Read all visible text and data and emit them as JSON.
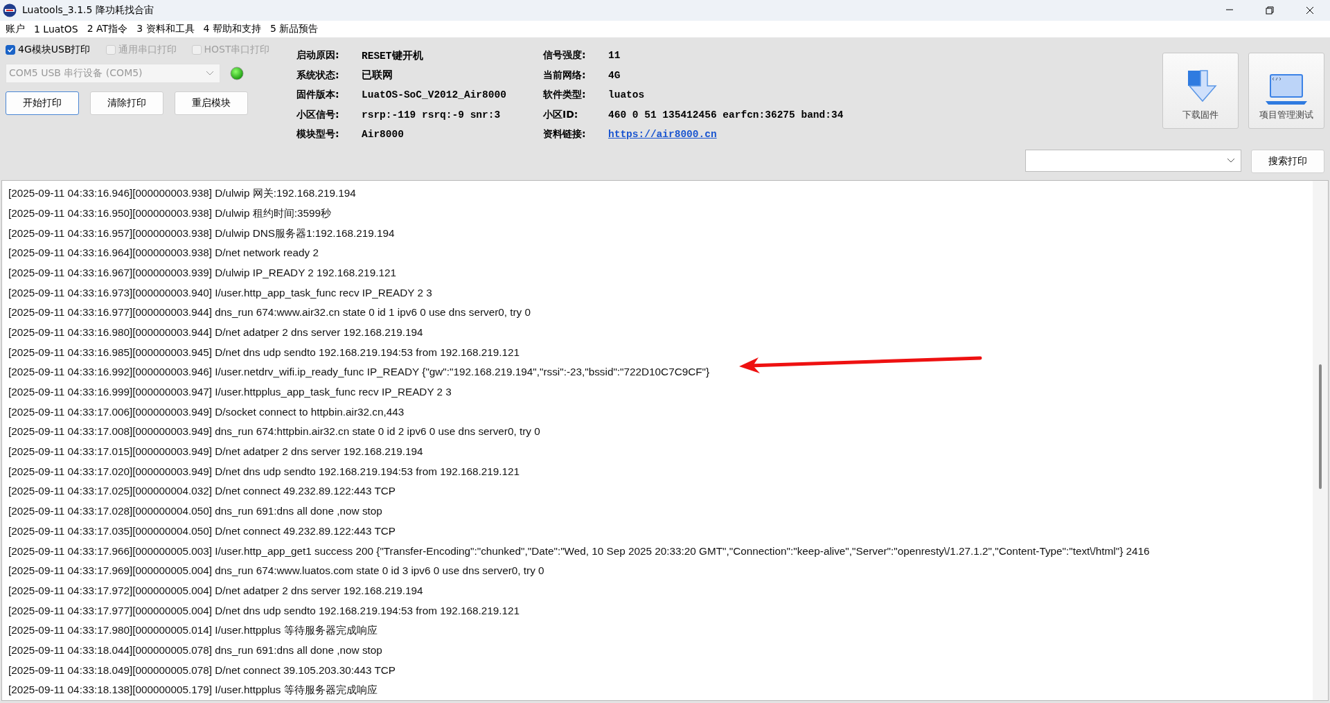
{
  "window": {
    "title": "Luatools_3.1.5 降功耗找合宙"
  },
  "menu": [
    "账户",
    "1 LuatOS",
    "2 AT指令",
    "3 资料和工具",
    "4 帮助和支持",
    "5 新品预告"
  ],
  "print_options": [
    {
      "label": "4G模块USB打印",
      "checked": true,
      "disabled": false
    },
    {
      "label": "通用串口打印",
      "checked": false,
      "disabled": true
    },
    {
      "label": "HOST串口打印",
      "checked": false,
      "disabled": true
    }
  ],
  "port_select": {
    "value": "COM5 USB 串行设备 (COM5)",
    "disabled": true
  },
  "buttons": [
    "开始打印",
    "清除打印",
    "重启模块"
  ],
  "info_columns": [
    [
      {
        "label": "启动原因:",
        "value": "RESET键开机",
        "kind": "text"
      },
      {
        "label": "系统状态:",
        "value": "已联网",
        "kind": "text"
      },
      {
        "label": "固件版本:",
        "value": "LuatOS-SoC_V2012_Air8000",
        "kind": "text"
      },
      {
        "label": "小区信号:",
        "value": "rsrp:-119 rsrq:-9 snr:3",
        "kind": "text"
      },
      {
        "label": "模块型号:",
        "value": "Air8000",
        "kind": "text"
      }
    ],
    [
      {
        "label": "信号强度:",
        "value": "11",
        "kind": "text"
      },
      {
        "label": "当前网络:",
        "value": "4G",
        "kind": "text"
      },
      {
        "label": "软件类型:",
        "value": "luatos",
        "kind": "text"
      },
      {
        "label": "小区ID:",
        "value": "460 0 51 135412456 earfcn:36275 band:34",
        "kind": "text"
      },
      {
        "label": "资料链接:",
        "value": "https://air8000.cn",
        "kind": "link"
      }
    ]
  ],
  "tool_buttons": [
    {
      "label": "下载固件",
      "kind": "download"
    },
    {
      "label": "项目管理测试",
      "kind": "laptop"
    }
  ],
  "search_button": "搜索打印",
  "log": [
    "[2025-09-11 04:33:16.946][000000003.938] D/ulwip 网关:192.168.219.194",
    "[2025-09-11 04:33:16.950][000000003.938] D/ulwip 租约时间:3599秒",
    "[2025-09-11 04:33:16.957][000000003.938] D/ulwip DNS服务器1:192.168.219.194",
    "[2025-09-11 04:33:16.964][000000003.938] D/net network ready 2",
    "[2025-09-11 04:33:16.967][000000003.939] D/ulwip IP_READY 2 192.168.219.121",
    "[2025-09-11 04:33:16.973][000000003.940] I/user.http_app_task_func recv IP_READY 2 3",
    "[2025-09-11 04:33:16.977][000000003.944] dns_run 674:www.air32.cn state 0 id 1 ipv6 0 use dns server0, try 0",
    "[2025-09-11 04:33:16.980][000000003.944] D/net adatper 2 dns server 192.168.219.194",
    "[2025-09-11 04:33:16.985][000000003.945] D/net dns udp sendto 192.168.219.194:53 from 192.168.219.121",
    "[2025-09-11 04:33:16.992][000000003.946] I/user.netdrv_wifi.ip_ready_func IP_READY {\"gw\":\"192.168.219.194\",\"rssi\":-23,\"bssid\":\"722D10C7C9CF\"}",
    "[2025-09-11 04:33:16.999][000000003.947] I/user.httpplus_app_task_func recv IP_READY 2 3",
    "[2025-09-11 04:33:17.006][000000003.949] D/socket connect to httpbin.air32.cn,443",
    "[2025-09-11 04:33:17.008][000000003.949] dns_run 674:httpbin.air32.cn state 0 id 2 ipv6 0 use dns server0, try 0",
    "[2025-09-11 04:33:17.015][000000003.949] D/net adatper 2 dns server 192.168.219.194",
    "[2025-09-11 04:33:17.020][000000003.949] D/net dns udp sendto 192.168.219.194:53 from 192.168.219.121",
    "[2025-09-11 04:33:17.025][000000004.032] D/net connect 49.232.89.122:443 TCP",
    "[2025-09-11 04:33:17.028][000000004.050] dns_run 691:dns all done ,now stop",
    "[2025-09-11 04:33:17.035][000000004.050] D/net connect 49.232.89.122:443 TCP",
    "[2025-09-11 04:33:17.966][000000005.003] I/user.http_app_get1 success 200 {\"Transfer-Encoding\":\"chunked\",\"Date\":\"Wed, 10 Sep 2025 20:33:20 GMT\",\"Connection\":\"keep-alive\",\"Server\":\"openresty\\/1.27.1.2\",\"Content-Type\":\"text\\/html\"} 2416",
    "[2025-09-11 04:33:17.969][000000005.004] dns_run 674:www.luatos.com state 0 id 3 ipv6 0 use dns server0, try 0",
    "[2025-09-11 04:33:17.972][000000005.004] D/net adatper 2 dns server 192.168.219.194",
    "[2025-09-11 04:33:17.977][000000005.004] D/net dns udp sendto 192.168.219.194:53 from 192.168.219.121",
    "[2025-09-11 04:33:17.980][000000005.014] I/user.httpplus 等待服务器完成响应",
    "[2025-09-11 04:33:18.044][000000005.078] dns_run 691:dns all done ,now stop",
    "[2025-09-11 04:33:18.049][000000005.078] D/net connect 39.105.203.30:443 TCP",
    "[2025-09-11 04:33:18.138][000000005.179] I/user.httpplus 等待服务器完成响应"
  ]
}
